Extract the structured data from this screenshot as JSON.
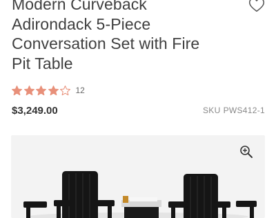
{
  "product": {
    "title_lines": [
      "Modern Curveback",
      "Adirondack 5-Piece",
      "Conversation Set with Fire",
      "Pit Table"
    ],
    "rating": 4,
    "rating_max": 5,
    "review_count": "12",
    "price": "$3,249.00",
    "sku_label": "SKU",
    "sku_value": "PWS412-1"
  },
  "icons": {
    "wishlist": "heart-outline-icon",
    "zoom": "zoom-in-icon",
    "star_full": "star-filled-icon",
    "star_empty": "star-outline-icon"
  },
  "colors": {
    "star": "#e8907a",
    "text": "#3f3f3f",
    "image_bg": "#f3f3f3",
    "chair": "#151515"
  }
}
